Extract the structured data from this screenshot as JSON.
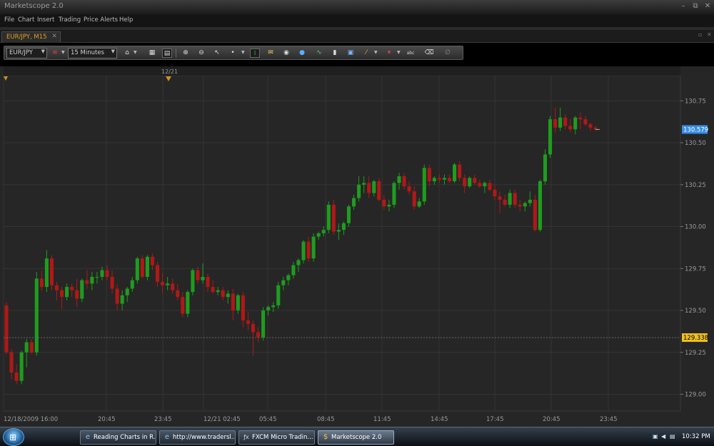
{
  "window": {
    "title": "Marketscope 2.0",
    "controls": [
      "–",
      "⧉",
      "✕"
    ]
  },
  "menu": [
    "File",
    "Chart",
    "Insert",
    "Trading",
    "Price Alerts",
    "Help"
  ],
  "chart_tab": {
    "label": "EUR/JPY, M15",
    "close": "✕"
  },
  "toolbar": {
    "symbol": "EUR/JPY",
    "timeframe": "15 Minutes",
    "icons": [
      "chart-type-icon",
      "layout-icon",
      "grid-icon",
      "zoom-in-icon",
      "zoom-out-icon",
      "cursor-icon",
      "dot-icon",
      "crosshair-icon",
      "note-icon",
      "eye-icon",
      "globe-icon",
      "indicator-icon",
      "marker-icon",
      "image-icon",
      "pencil-icon",
      "color-icon",
      "abc-text-icon",
      "eraser-icon",
      "lock-icon"
    ]
  },
  "chart_data": {
    "type": "candlestick",
    "title": "",
    "xlabel": "",
    "ylabel": "",
    "ylim": [
      128.9,
      130.9
    ],
    "y_ticks": [
      130.75,
      130.5,
      130.25,
      130.0,
      129.75,
      129.5,
      129.25,
      129.0
    ],
    "x_tick_labels": [
      "12/18/2009 16:00",
      "20:45",
      "23:45",
      "12/21 02:45",
      "05:45",
      "08:45",
      "11:45",
      "14:45",
      "17:45",
      "20:45",
      "23:45"
    ],
    "top_marker_label": "12/21",
    "current_price": "130.579",
    "reference_price": "129.338",
    "colors": {
      "up": "#1e9c1e",
      "down": "#b01818",
      "background": "#262626",
      "grid": "#343434",
      "current_price_bg": "#3a8ee6",
      "reference_price_bg": "#f0c020"
    },
    "candles": [
      {
        "o": 129.53,
        "h": 129.55,
        "l": 129.24,
        "c": 129.25
      },
      {
        "o": 129.25,
        "h": 129.27,
        "l": 129.09,
        "c": 129.13
      },
      {
        "o": 129.13,
        "h": 129.18,
        "l": 129.06,
        "c": 129.08
      },
      {
        "o": 129.08,
        "h": 129.26,
        "l": 129.06,
        "c": 129.25
      },
      {
        "o": 129.25,
        "h": 129.33,
        "l": 129.16,
        "c": 129.31
      },
      {
        "o": 129.31,
        "h": 129.33,
        "l": 129.24,
        "c": 129.25
      },
      {
        "o": 129.25,
        "h": 129.73,
        "l": 129.23,
        "c": 129.69
      },
      {
        "o": 129.69,
        "h": 129.74,
        "l": 129.62,
        "c": 129.64
      },
      {
        "o": 129.64,
        "h": 129.86,
        "l": 129.61,
        "c": 129.81
      },
      {
        "o": 129.81,
        "h": 129.83,
        "l": 129.62,
        "c": 129.65
      },
      {
        "o": 129.65,
        "h": 129.67,
        "l": 129.56,
        "c": 129.62
      },
      {
        "o": 129.62,
        "h": 129.64,
        "l": 129.51,
        "c": 129.58
      },
      {
        "o": 129.58,
        "h": 129.66,
        "l": 129.56,
        "c": 129.64
      },
      {
        "o": 129.64,
        "h": 129.66,
        "l": 129.58,
        "c": 129.62
      },
      {
        "o": 129.62,
        "h": 129.69,
        "l": 129.52,
        "c": 129.57
      },
      {
        "o": 129.57,
        "h": 129.69,
        "l": 129.55,
        "c": 129.68
      },
      {
        "o": 129.68,
        "h": 129.74,
        "l": 129.63,
        "c": 129.66
      },
      {
        "o": 129.66,
        "h": 129.73,
        "l": 129.62,
        "c": 129.7
      },
      {
        "o": 129.7,
        "h": 129.73,
        "l": 129.66,
        "c": 129.7
      },
      {
        "o": 129.7,
        "h": 129.76,
        "l": 129.68,
        "c": 129.74
      },
      {
        "o": 129.74,
        "h": 129.77,
        "l": 129.68,
        "c": 129.7
      },
      {
        "o": 129.7,
        "h": 129.74,
        "l": 129.6,
        "c": 129.63
      },
      {
        "o": 129.63,
        "h": 129.66,
        "l": 129.5,
        "c": 129.54
      },
      {
        "o": 129.54,
        "h": 129.62,
        "l": 129.5,
        "c": 129.59
      },
      {
        "o": 129.59,
        "h": 129.64,
        "l": 129.55,
        "c": 129.63
      },
      {
        "o": 129.63,
        "h": 129.7,
        "l": 129.61,
        "c": 129.68
      },
      {
        "o": 129.68,
        "h": 129.82,
        "l": 129.66,
        "c": 129.81
      },
      {
        "o": 129.81,
        "h": 129.83,
        "l": 129.69,
        "c": 129.7
      },
      {
        "o": 129.7,
        "h": 129.83,
        "l": 129.68,
        "c": 129.82
      },
      {
        "o": 129.82,
        "h": 129.84,
        "l": 129.74,
        "c": 129.77
      },
      {
        "o": 129.77,
        "h": 129.79,
        "l": 129.64,
        "c": 129.67
      },
      {
        "o": 129.67,
        "h": 129.72,
        "l": 129.6,
        "c": 129.65
      },
      {
        "o": 129.65,
        "h": 129.7,
        "l": 129.62,
        "c": 129.66
      },
      {
        "o": 129.66,
        "h": 129.69,
        "l": 129.6,
        "c": 129.62
      },
      {
        "o": 129.62,
        "h": 129.66,
        "l": 129.56,
        "c": 129.58
      },
      {
        "o": 129.58,
        "h": 129.61,
        "l": 129.46,
        "c": 129.48
      },
      {
        "o": 129.48,
        "h": 129.62,
        "l": 129.46,
        "c": 129.61
      },
      {
        "o": 129.61,
        "h": 129.75,
        "l": 129.59,
        "c": 129.74
      },
      {
        "o": 129.74,
        "h": 129.76,
        "l": 129.66,
        "c": 129.68
      },
      {
        "o": 129.68,
        "h": 129.78,
        "l": 129.66,
        "c": 129.7
      },
      {
        "o": 129.7,
        "h": 129.72,
        "l": 129.61,
        "c": 129.64
      },
      {
        "o": 129.64,
        "h": 129.68,
        "l": 129.6,
        "c": 129.61
      },
      {
        "o": 129.61,
        "h": 129.64,
        "l": 129.59,
        "c": 129.62
      },
      {
        "o": 129.62,
        "h": 129.64,
        "l": 129.56,
        "c": 129.58
      },
      {
        "o": 129.58,
        "h": 129.62,
        "l": 129.54,
        "c": 129.6
      },
      {
        "o": 129.6,
        "h": 129.63,
        "l": 129.44,
        "c": 129.5
      },
      {
        "o": 129.5,
        "h": 129.6,
        "l": 129.48,
        "c": 129.59
      },
      {
        "o": 129.59,
        "h": 129.61,
        "l": 129.4,
        "c": 129.44
      },
      {
        "o": 129.44,
        "h": 129.49,
        "l": 129.38,
        "c": 129.42
      },
      {
        "o": 129.42,
        "h": 129.44,
        "l": 129.23,
        "c": 129.37
      },
      {
        "o": 129.37,
        "h": 129.4,
        "l": 129.31,
        "c": 129.34
      },
      {
        "o": 129.34,
        "h": 129.52,
        "l": 129.32,
        "c": 129.5
      },
      {
        "o": 129.5,
        "h": 129.53,
        "l": 129.47,
        "c": 129.52
      },
      {
        "o": 129.52,
        "h": 129.55,
        "l": 129.49,
        "c": 129.53
      },
      {
        "o": 129.53,
        "h": 129.67,
        "l": 129.51,
        "c": 129.65
      },
      {
        "o": 129.65,
        "h": 129.7,
        "l": 129.62,
        "c": 129.68
      },
      {
        "o": 129.68,
        "h": 129.72,
        "l": 129.65,
        "c": 129.71
      },
      {
        "o": 129.71,
        "h": 129.79,
        "l": 129.69,
        "c": 129.77
      },
      {
        "o": 129.77,
        "h": 129.81,
        "l": 129.73,
        "c": 129.8
      },
      {
        "o": 129.8,
        "h": 129.92,
        "l": 129.78,
        "c": 129.91
      },
      {
        "o": 129.91,
        "h": 129.94,
        "l": 129.79,
        "c": 129.81
      },
      {
        "o": 129.81,
        "h": 129.96,
        "l": 129.79,
        "c": 129.94
      },
      {
        "o": 129.94,
        "h": 129.97,
        "l": 129.92,
        "c": 129.96
      },
      {
        "o": 129.96,
        "h": 130.0,
        "l": 129.94,
        "c": 129.98
      },
      {
        "o": 129.98,
        "h": 130.15,
        "l": 129.96,
        "c": 130.13
      },
      {
        "o": 130.13,
        "h": 130.16,
        "l": 129.95,
        "c": 129.97
      },
      {
        "o": 129.97,
        "h": 130.02,
        "l": 129.92,
        "c": 129.98
      },
      {
        "o": 129.98,
        "h": 130.03,
        "l": 129.95,
        "c": 130.02
      },
      {
        "o": 130.02,
        "h": 130.13,
        "l": 130.0,
        "c": 130.12
      },
      {
        "o": 130.12,
        "h": 130.19,
        "l": 130.1,
        "c": 130.17
      },
      {
        "o": 130.17,
        "h": 130.3,
        "l": 130.15,
        "c": 130.25
      },
      {
        "o": 130.25,
        "h": 130.3,
        "l": 130.2,
        "c": 130.26
      },
      {
        "o": 130.26,
        "h": 130.3,
        "l": 130.17,
        "c": 130.2
      },
      {
        "o": 130.2,
        "h": 130.28,
        "l": 130.18,
        "c": 130.27
      },
      {
        "o": 130.27,
        "h": 130.29,
        "l": 130.15,
        "c": 130.16
      },
      {
        "o": 130.16,
        "h": 130.19,
        "l": 130.1,
        "c": 130.12
      },
      {
        "o": 130.12,
        "h": 130.16,
        "l": 130.09,
        "c": 130.13
      },
      {
        "o": 130.13,
        "h": 130.27,
        "l": 130.11,
        "c": 130.26
      },
      {
        "o": 130.26,
        "h": 130.32,
        "l": 130.22,
        "c": 130.3
      },
      {
        "o": 130.3,
        "h": 130.32,
        "l": 130.22,
        "c": 130.24
      },
      {
        "o": 130.24,
        "h": 130.27,
        "l": 130.19,
        "c": 130.21
      },
      {
        "o": 130.21,
        "h": 130.24,
        "l": 130.1,
        "c": 130.12
      },
      {
        "o": 130.12,
        "h": 130.17,
        "l": 130.11,
        "c": 130.15
      },
      {
        "o": 130.15,
        "h": 130.37,
        "l": 130.13,
        "c": 130.35
      },
      {
        "o": 130.35,
        "h": 130.37,
        "l": 130.24,
        "c": 130.27
      },
      {
        "o": 130.27,
        "h": 130.3,
        "l": 130.25,
        "c": 130.29
      },
      {
        "o": 130.29,
        "h": 130.31,
        "l": 130.26,
        "c": 130.28
      },
      {
        "o": 130.28,
        "h": 130.31,
        "l": 130.25,
        "c": 130.29
      },
      {
        "o": 130.29,
        "h": 130.31,
        "l": 130.26,
        "c": 130.27
      },
      {
        "o": 130.27,
        "h": 130.38,
        "l": 130.26,
        "c": 130.37
      },
      {
        "o": 130.37,
        "h": 130.39,
        "l": 130.27,
        "c": 130.29
      },
      {
        "o": 130.29,
        "h": 130.31,
        "l": 130.2,
        "c": 130.24
      },
      {
        "o": 130.24,
        "h": 130.3,
        "l": 130.23,
        "c": 130.29
      },
      {
        "o": 130.29,
        "h": 130.31,
        "l": 130.25,
        "c": 130.26
      },
      {
        "o": 130.26,
        "h": 130.28,
        "l": 130.23,
        "c": 130.24
      },
      {
        "o": 130.24,
        "h": 130.27,
        "l": 130.2,
        "c": 130.26
      },
      {
        "o": 130.26,
        "h": 130.28,
        "l": 130.21,
        "c": 130.22
      },
      {
        "o": 130.22,
        "h": 130.25,
        "l": 130.16,
        "c": 130.18
      },
      {
        "o": 130.18,
        "h": 130.21,
        "l": 130.08,
        "c": 130.16
      },
      {
        "o": 130.16,
        "h": 130.19,
        "l": 130.12,
        "c": 130.13
      },
      {
        "o": 130.13,
        "h": 130.22,
        "l": 130.11,
        "c": 130.2
      },
      {
        "o": 130.2,
        "h": 130.22,
        "l": 130.11,
        "c": 130.13
      },
      {
        "o": 130.13,
        "h": 130.16,
        "l": 130.09,
        "c": 130.12
      },
      {
        "o": 130.12,
        "h": 130.15,
        "l": 130.09,
        "c": 130.14
      },
      {
        "o": 130.14,
        "h": 130.21,
        "l": 130.12,
        "c": 130.16
      },
      {
        "o": 130.16,
        "h": 130.19,
        "l": 129.97,
        "c": 129.98
      },
      {
        "o": 129.98,
        "h": 130.28,
        "l": 129.97,
        "c": 130.27
      },
      {
        "o": 130.27,
        "h": 130.46,
        "l": 130.25,
        "c": 130.43
      },
      {
        "o": 130.43,
        "h": 130.66,
        "l": 130.41,
        "c": 130.64
      },
      {
        "o": 130.64,
        "h": 130.71,
        "l": 130.56,
        "c": 130.59
      },
      {
        "o": 130.59,
        "h": 130.71,
        "l": 130.57,
        "c": 130.65
      },
      {
        "o": 130.65,
        "h": 130.67,
        "l": 130.58,
        "c": 130.6
      },
      {
        "o": 130.6,
        "h": 130.64,
        "l": 130.56,
        "c": 130.58
      },
      {
        "o": 130.58,
        "h": 130.66,
        "l": 130.55,
        "c": 130.65
      },
      {
        "o": 130.65,
        "h": 130.68,
        "l": 130.58,
        "c": 130.64
      },
      {
        "o": 130.64,
        "h": 130.66,
        "l": 130.6,
        "c": 130.61
      },
      {
        "o": 130.61,
        "h": 130.62,
        "l": 130.57,
        "c": 130.59
      },
      {
        "o": 130.59,
        "h": 130.6,
        "l": 130.57,
        "c": 130.579
      }
    ]
  },
  "taskbar": {
    "start": "⊞",
    "tasks": [
      {
        "icon": "ie-icon",
        "glyph": "e",
        "label": "Reading Charts in R..."
      },
      {
        "icon": "ie-icon",
        "glyph": "e",
        "label": "http://www.tradersl..."
      },
      {
        "icon": "fxcm-icon",
        "glyph": "ƒx",
        "label": "FXCM Micro Tradin..."
      },
      {
        "icon": "dollar-icon",
        "glyph": "$",
        "label": "Marketscope 2.0"
      }
    ],
    "clock": "10:32 PM"
  }
}
